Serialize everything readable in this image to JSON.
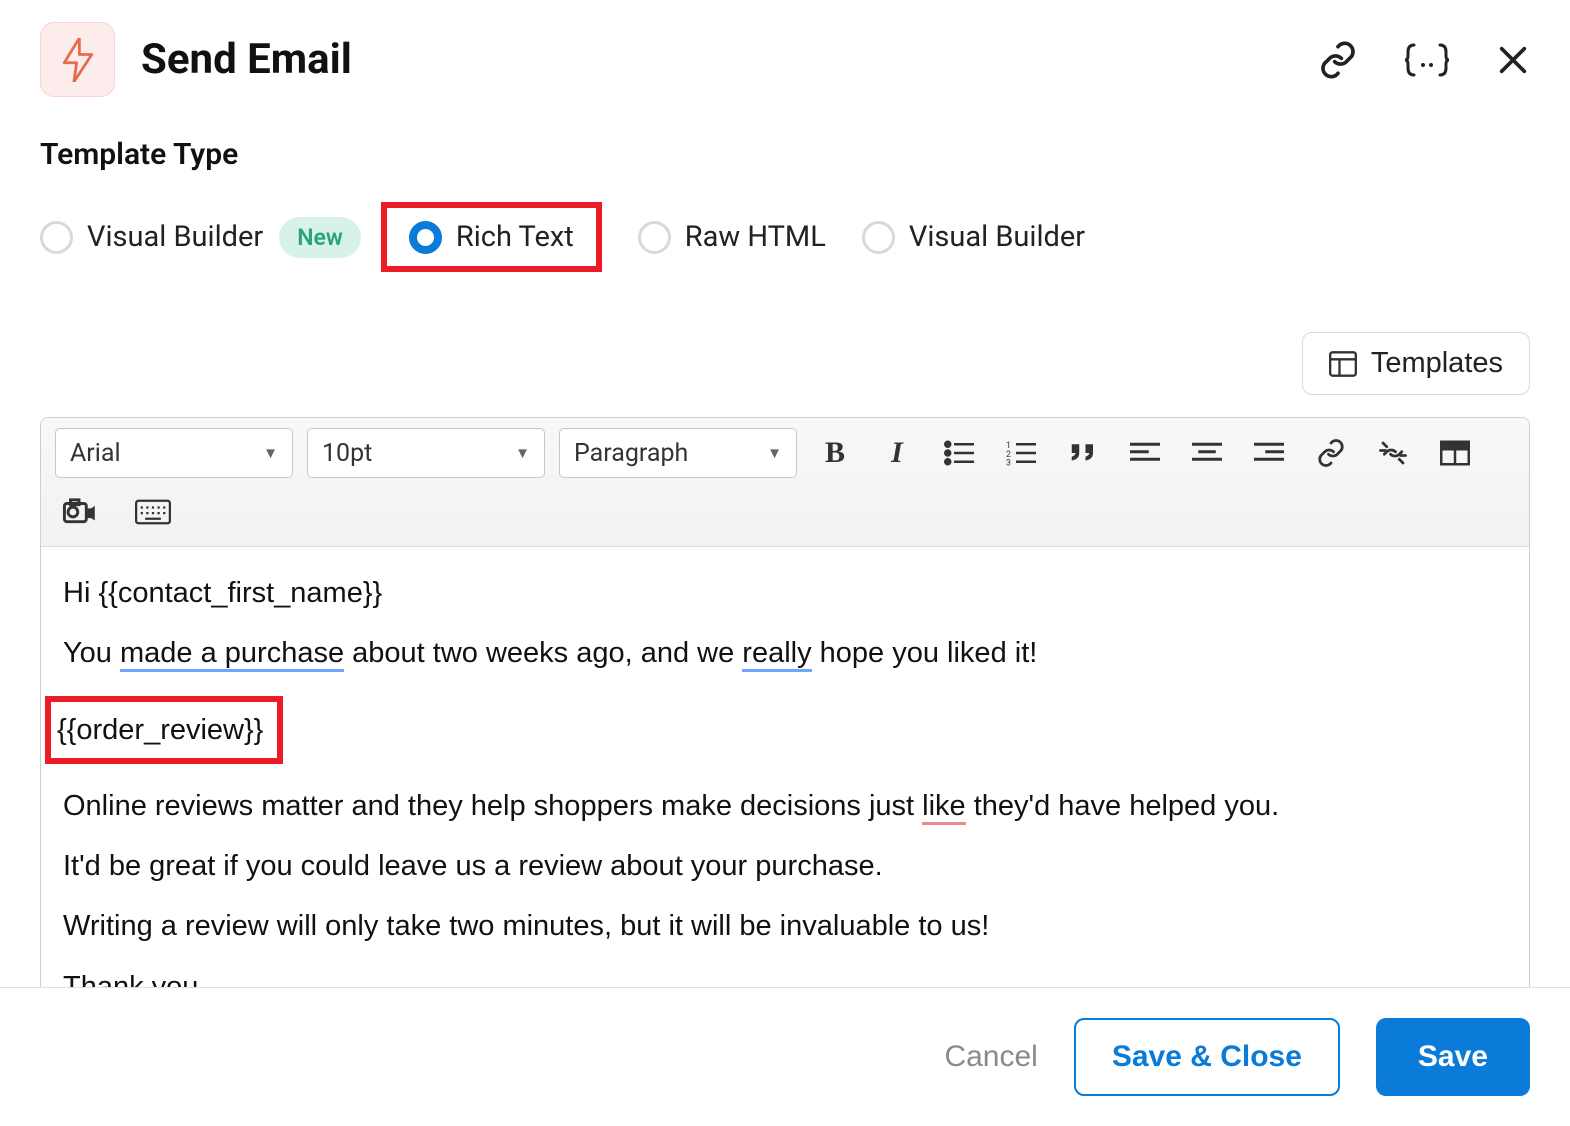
{
  "header": {
    "title": "Send Email"
  },
  "templateType": {
    "label": "Template Type",
    "options": [
      {
        "label": "Visual Builder",
        "selected": false,
        "new_badge": "New"
      },
      {
        "label": "Rich Text",
        "selected": true
      },
      {
        "label": "Raw HTML",
        "selected": false
      },
      {
        "label": "Visual Builder",
        "selected": false
      }
    ]
  },
  "templatesButton": "Templates",
  "toolbar": {
    "font": "Arial",
    "size": "10pt",
    "block": "Paragraph"
  },
  "body": {
    "p1": "Hi {{contact_first_name}}",
    "p2_a": "You ",
    "p2_b": "made a purchase",
    "p2_c": " about two weeks ago, and we ",
    "p2_d": "really",
    "p2_e": " hope you liked it!",
    "p3": "{{order_review}}",
    "p4_a": "Online reviews matter and they help shoppers make decisions just ",
    "p4_b": "like",
    "p4_c": " they'd have helped you.",
    "p5": "It'd be great if you could leave us a review about your purchase.",
    "p6": "Writing a review will only take two minutes, but it will be invaluable to us!",
    "p7": "Thank you"
  },
  "footer": {
    "cancel": "Cancel",
    "saveClose": "Save & Close",
    "save": "Save"
  }
}
